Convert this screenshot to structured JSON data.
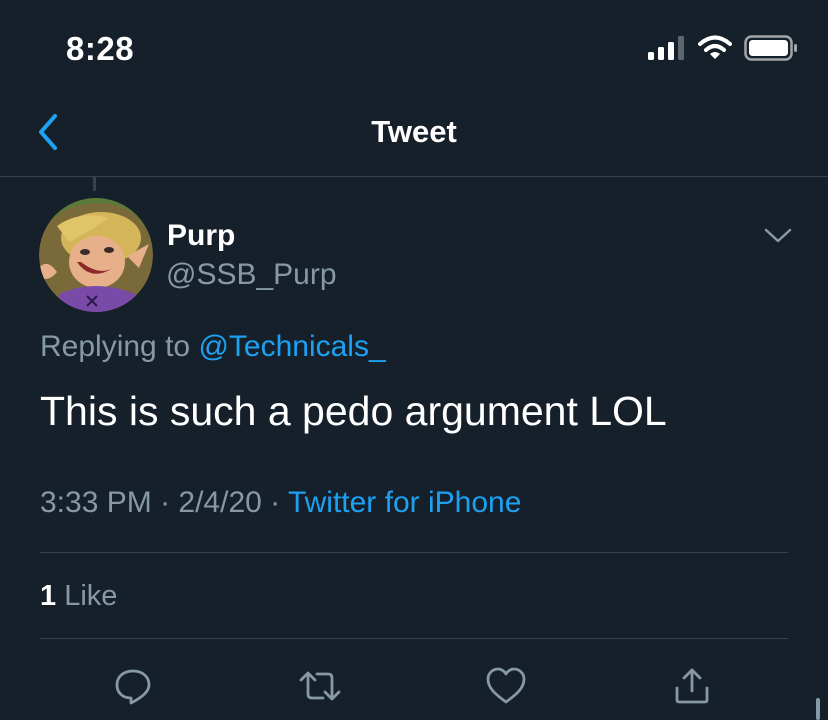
{
  "status_bar": {
    "time": "8:28",
    "icons": [
      "cellular-signal-icon",
      "wifi-icon",
      "battery-icon"
    ]
  },
  "nav": {
    "title": "Tweet",
    "back_icon": "chevron-left-icon"
  },
  "tweet": {
    "author": {
      "display_name": "Purp",
      "handle": "@SSB_Purp"
    },
    "replying_prefix": "Replying to ",
    "replying_to": "@Technicals_",
    "text": "This is such a pedo argument LOL",
    "time": "3:33 PM",
    "date": "2/4/20",
    "separator": " · ",
    "source": "Twitter for iPhone",
    "likes_count": "1",
    "likes_label": " Like"
  },
  "actions": [
    "reply-icon",
    "retweet-icon",
    "like-icon",
    "share-icon"
  ],
  "colors": {
    "background": "#15202b",
    "accent": "#1da1f2",
    "secondary_text": "#8899a6",
    "divider": "#38444d"
  }
}
